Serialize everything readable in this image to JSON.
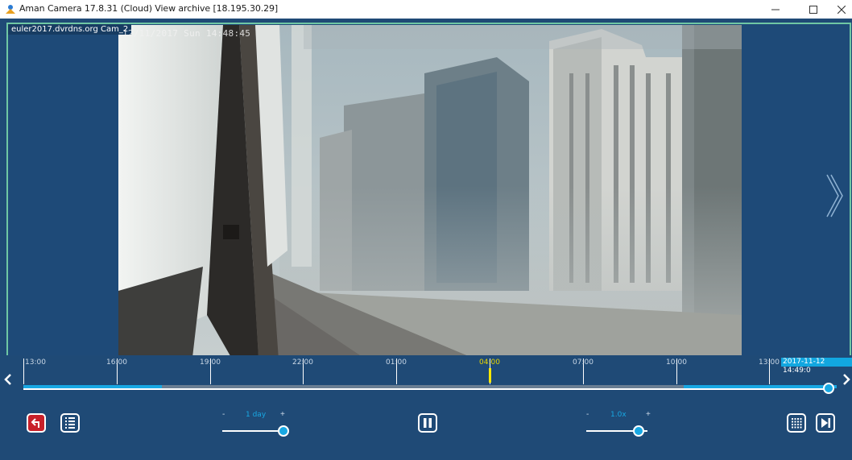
{
  "window": {
    "title": "Aman Camera 17.8.31 (Cloud) View archive [18.195.30.29]",
    "controls": {
      "minimize": "–",
      "maximize": "☐",
      "close": "✕"
    }
  },
  "camera": {
    "label": "euler2017.dvrdns.org Cam_2",
    "osd_timestamp": "12/11/2017 Sun 14:48:45"
  },
  "timeline": {
    "ticks": [
      {
        "label": "13:00",
        "current": false
      },
      {
        "label": "16:00",
        "current": false
      },
      {
        "label": "19:00",
        "current": false
      },
      {
        "label": "22:00",
        "current": false
      },
      {
        "label": "01:00",
        "current": false
      },
      {
        "label": "04:00",
        "current": true
      },
      {
        "label": "07:00",
        "current": false
      },
      {
        "label": "10:00",
        "current": false
      },
      {
        "label": "13:00",
        "current": false
      }
    ],
    "position_badge": "2017-11-12 14:49:0",
    "playhead_fraction": 0.995
  },
  "controls": {
    "zoom": {
      "minus": "-",
      "plus": "+",
      "value": "1 day",
      "level": 1.0
    },
    "speed": {
      "minus": "-",
      "plus": "+",
      "value": "1.0x",
      "level": 0.85
    },
    "icons": {
      "back": "return-arrow-icon",
      "list": "list-icon",
      "pause": "pause-icon",
      "grid": "grid-icon",
      "step": "step-forward-icon"
    }
  },
  "colors": {
    "background": "#1f4a76",
    "frame_border": "#6fc7a4",
    "accent": "#18a8e3",
    "marker": "#ffe700",
    "back_button": "#c8202a"
  }
}
